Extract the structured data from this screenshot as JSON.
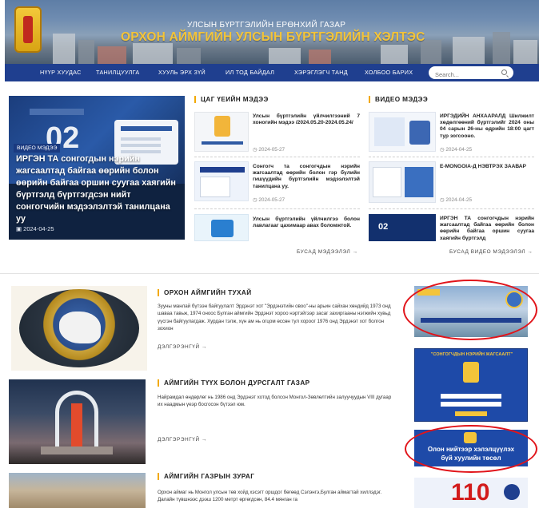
{
  "header": {
    "subtitle": "УЛСЫН БҮРТГЭЛИЙН ЕРӨНХИЙ ГАЗАР",
    "title": "ОРХОН АЙМГИЙН УЛСЫН БҮРТГЭЛИЙН ХЭЛТЭС",
    "colors": {
      "nav": "#1f3f8f",
      "title": "#f3c43a",
      "accent": "#f2a900"
    }
  },
  "nav": {
    "items": [
      "НҮҮР ХУУДАС",
      "ТАНИЛЦУУЛГА",
      "ХУУЛЬ ЭРХ ЗҮЙ",
      "ИЛ ТОД БАЙДАЛ",
      "ХЭРЭГЛЭГЧ ТАНД",
      "ХОЛБОО БАРИХ"
    ],
    "search_placeholder": "Search..."
  },
  "hero": {
    "tag": "ВИДЕО МЭДЭЭ",
    "title": "ИРГЭН ТА сонгогдын нэрийн жагсаалтад байгаа өөрийн болон өөрийн байгаа оршин суугаа хаягийн бүртгэлд бүртгэгдсэн нийт сонгогчийн мэдээлэлтэй танилцана уу",
    "date": "2024-04-25"
  },
  "news": {
    "heading": "ЦАГ ҮЕИЙН МЭДЭЭ",
    "items": [
      {
        "title": "Улсын бүртгэлийн үйлчилгээний 7 хоногийн мэдээ /2024.05.20-2024.05.24/",
        "date": "2024-05-27"
      },
      {
        "title": "Сонгогч та сонгогчдын нэрийн жагсаалтад өөрийн болон гэр бүлийн гишүүдийн бүртгэлийн мэдээлэлтэй танилцана уу.",
        "date": "2024-05-27"
      },
      {
        "title": "Улсын бүртгэлийн үйлчилгээ болон лавлагааг цахимаар авах боломжтой.",
        "date": ""
      }
    ],
    "more": "БУСАД МЭДЭЭЛЭЛ →"
  },
  "video": {
    "heading": "ВИДЕО МЭДЭЭ",
    "items": [
      {
        "title": "ИРГЭДИЙН АНХААРАЛД Шилжилт хөдөлгөөний бүртгэлийг 2024 оны 04 сарын 26-ны өдрийн 18:00 цагт тур зогсооно.",
        "date": "2024-04-25"
      },
      {
        "title": "E-MONGOIA-Д НЭВТРЭХ ЗААВАР",
        "date": "2024-04-25"
      },
      {
        "title": "ИРГЭН ТА сонгогчдын нэрийн жагсаалтад байгаа өөрийн болон өөрийн байгаа оршин суугаа хаягийн бүртгэлд",
        "date": ""
      }
    ],
    "more": "БУСАД ВИДЕО МЭДЭЭЛЭЛ →"
  },
  "sections": [
    {
      "heading": "ОРХОН АЙМГИЙН ТУХАЙ",
      "text": "Зууны манлай бүтээн байгуулалт Эрдэнэт хот \"Эрдэнэтийн овоо\"-ны арьин сайхан хөндийд 1973 онд шаваа тавьж, 1974 оноос Булган аймгийн Эрдэнэт хороо нэртэйгээр засаг захиргааны нэгжийн хувьд үүсгэн байгуулагдаж. Хурдан тэлж, хүн ам нь огцом өссөн тул хороог 1976 онд Эрдэнэт хот болгон зохион",
      "more": "ДЭЛГЭРЭНГҮЙ →"
    },
    {
      "heading": "АЙМГИЙН ТҮҮХ БОЛОН ДУРСГАЛТ ГАЗАР",
      "text": "Найрамдал өндөрлөг нь 1986 онд Эрдэнэт хотод болсон Монгол-Зөвлөлтийн залуучуудын VIII дугаар их наадмын үеэр босгосон бүтээл юм.",
      "more": "ДЭЛГЭРЭНГҮЙ →"
    },
    {
      "heading": "АЙМГИЙН ГАЗРЫН ЗУРАГ",
      "text": "Орхон аймаг нь Монгол улсын төв хойд хэсэгт оршдог бөгөөд Сэлэнгэ,Булган аймагтай хиллэдэг. Далайн түвшнээс дээш 1200 метрт өргөгдсөн, 84.4 мянган га",
      "more": ""
    }
  ],
  "banners": {
    "b2_title": "\"СОНГОГЧДЫН НЭРИЙН ЖАГСААЛТ\"",
    "b3_line1": "Олон нийтээр хэлэлцүүлэх",
    "b3_line2": "бүй хуулийн төсөл",
    "b4_number": "110"
  }
}
